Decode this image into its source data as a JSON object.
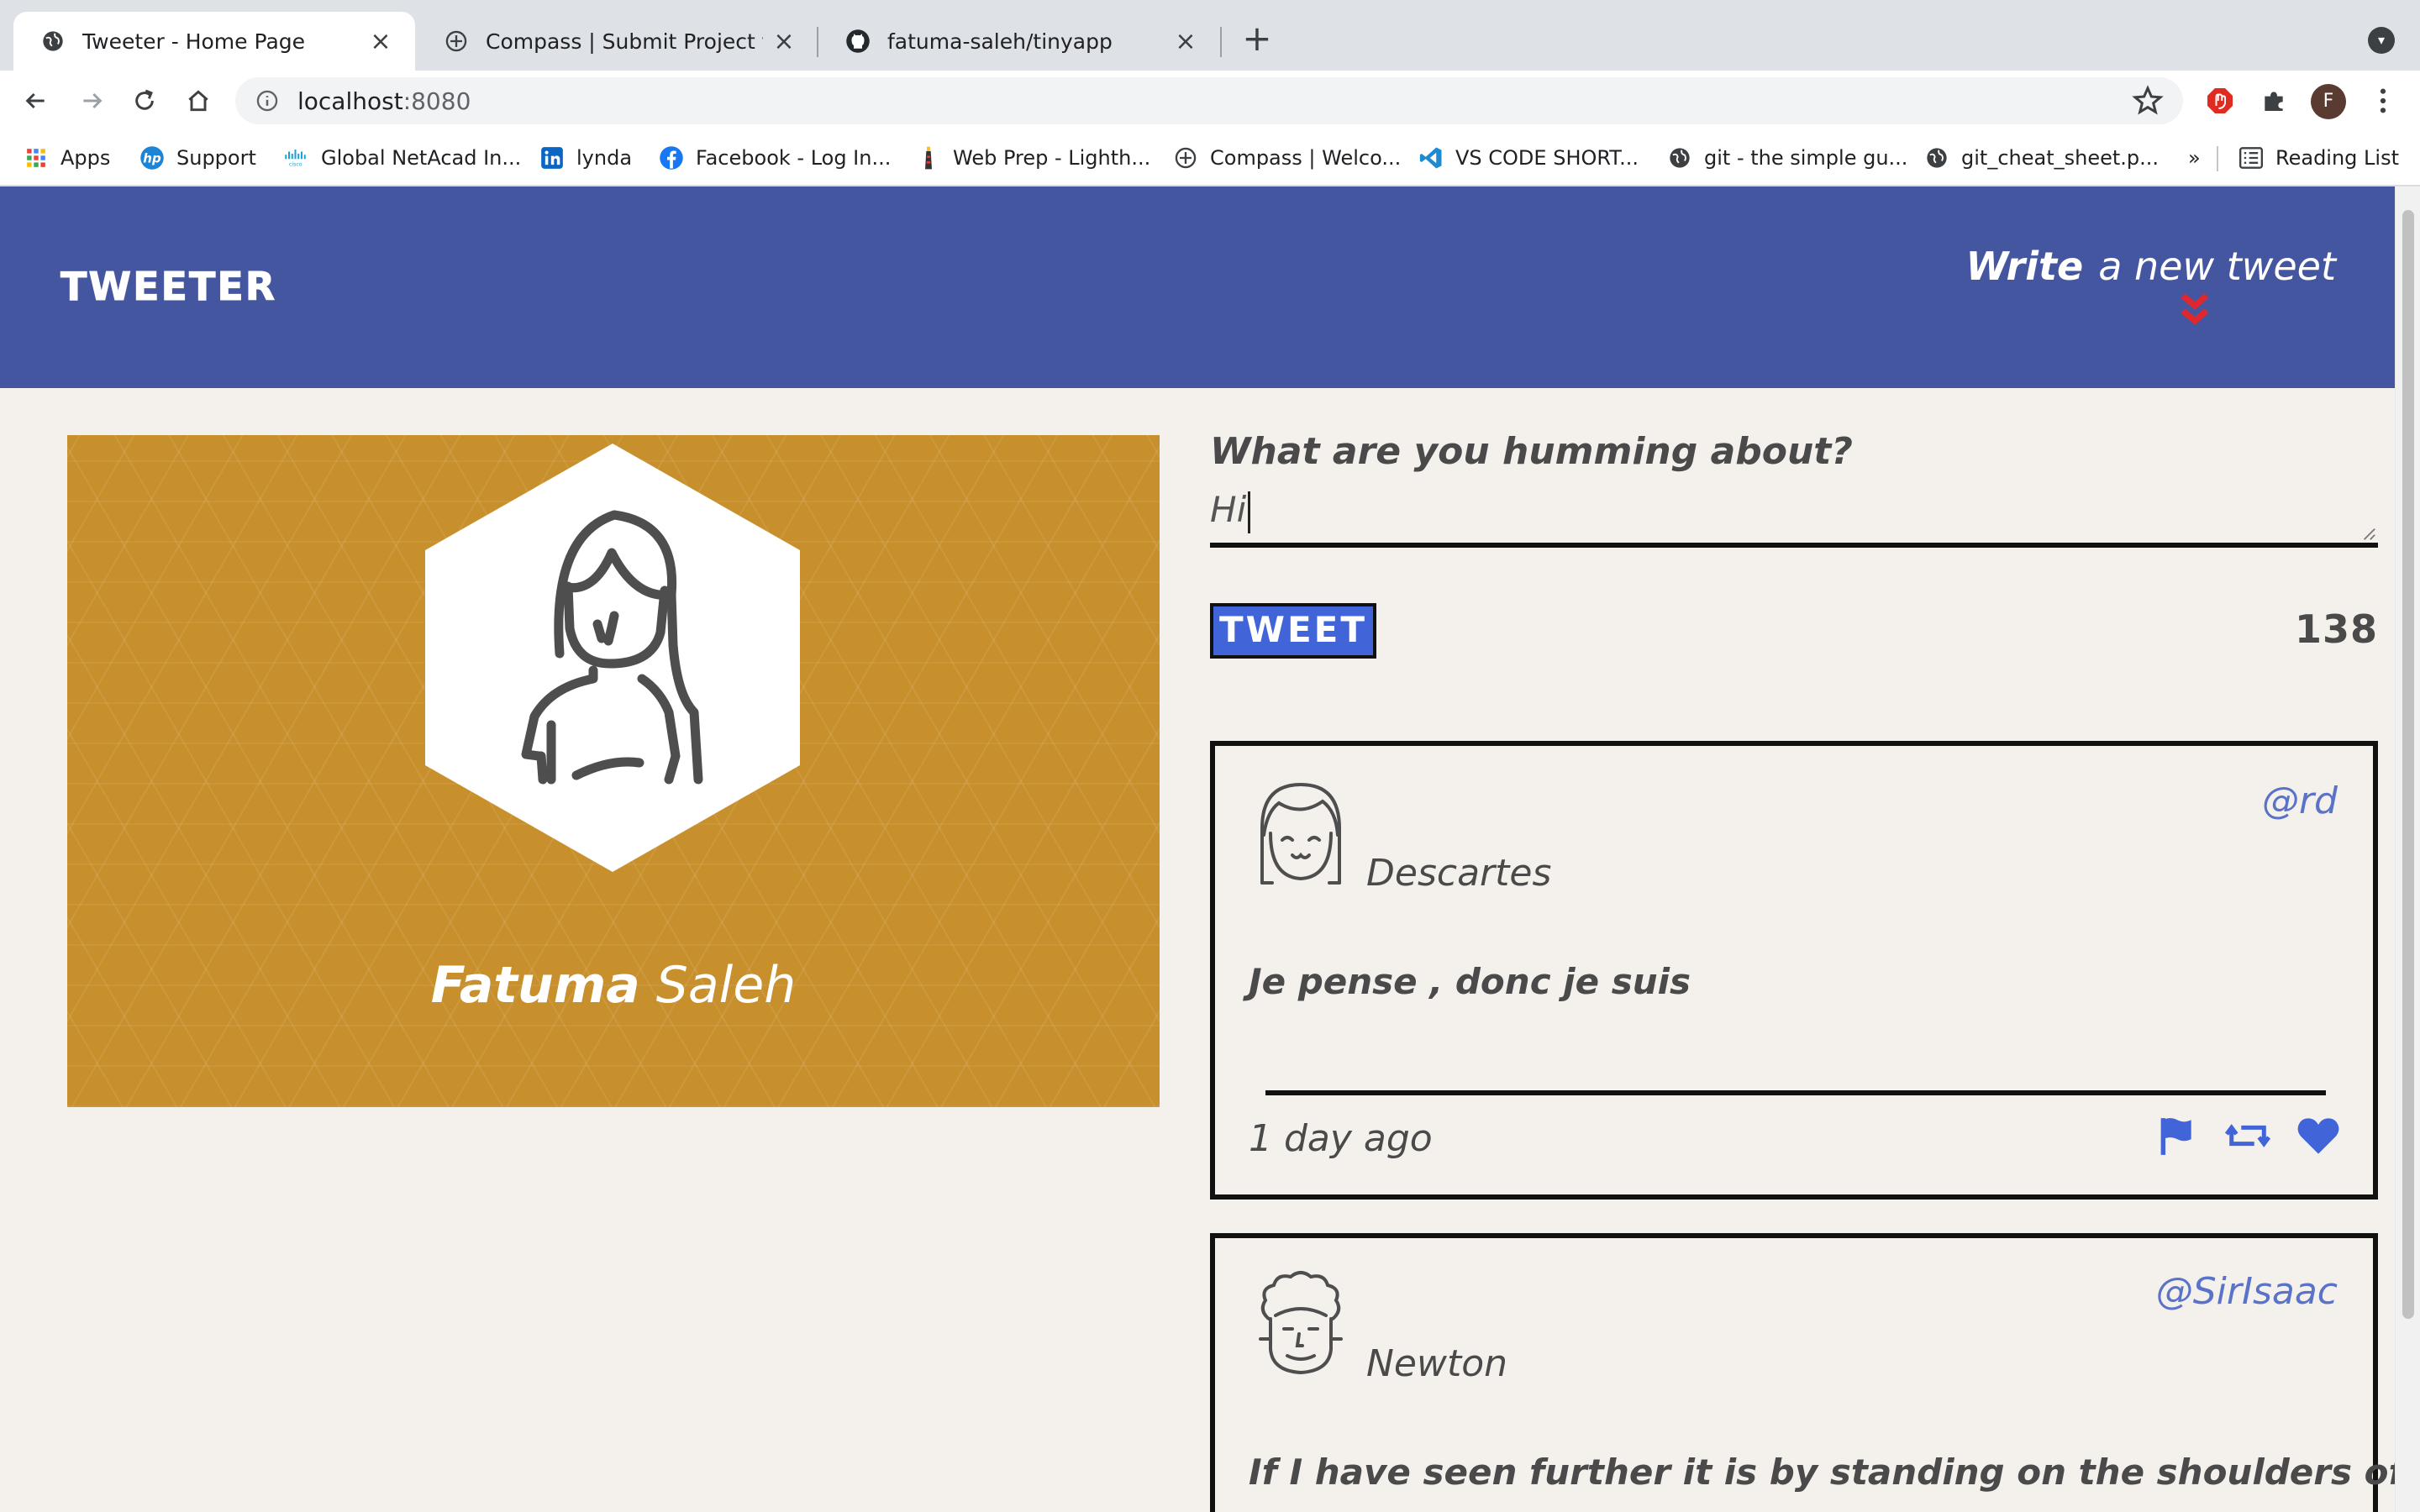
{
  "browser": {
    "tabs": [
      {
        "title": "Tweeter - Home Page",
        "icon": "globe-icon"
      },
      {
        "title": "Compass | Submit Project for E",
        "icon": "compass-icon"
      },
      {
        "title": "fatuma-saleh/tinyapp",
        "icon": "github-icon"
      }
    ],
    "url_host": "localhost",
    "url_port": ":8080",
    "profile_initial": "F",
    "bookmarks": [
      {
        "label": "Apps",
        "icon": "apps-grid-icon"
      },
      {
        "label": "Support",
        "icon": "hp-icon"
      },
      {
        "label": "Global NetAcad In...",
        "icon": "cisco-icon"
      },
      {
        "label": "lynda",
        "icon": "linkedin-icon"
      },
      {
        "label": "Facebook - Log In...",
        "icon": "facebook-icon"
      },
      {
        "label": "Web Prep - Lighth...",
        "icon": "lighthouse-icon"
      },
      {
        "label": "Compass | Welco...",
        "icon": "compass-icon"
      },
      {
        "label": "VS CODE SHORT...",
        "icon": "vscode-icon"
      },
      {
        "label": "git - the simple gu...",
        "icon": "globe-icon"
      },
      {
        "label": "git_cheat_sheet.p...",
        "icon": "globe-icon"
      }
    ],
    "overflow": "»",
    "reading_list": "Reading List"
  },
  "nav": {
    "brand": "TWEETER",
    "compose_bold": "Write",
    "compose_rest": "a new tweet"
  },
  "profile": {
    "first_name": "Fatuma",
    "last_name": "Saleh"
  },
  "composer": {
    "prompt": "What are you humming about?",
    "value": "Hi",
    "button": "TWEET",
    "counter": "138"
  },
  "tweets": [
    {
      "name": "Descartes",
      "handle": "@rd",
      "text": "Je pense , donc je suis",
      "time": "1 day ago"
    },
    {
      "name": "Newton",
      "handle": "@SirIsaac",
      "text": "If I have seen further it is by standing on the shoulders of giants"
    }
  ],
  "colors": {
    "nav_bg": "#4556a0",
    "page_bg": "#f4f1ec",
    "card_bg": "#c8902d",
    "accent_blue": "#4164d8",
    "handle_blue": "#5b72c9",
    "chevron_red": "#e0272b"
  }
}
